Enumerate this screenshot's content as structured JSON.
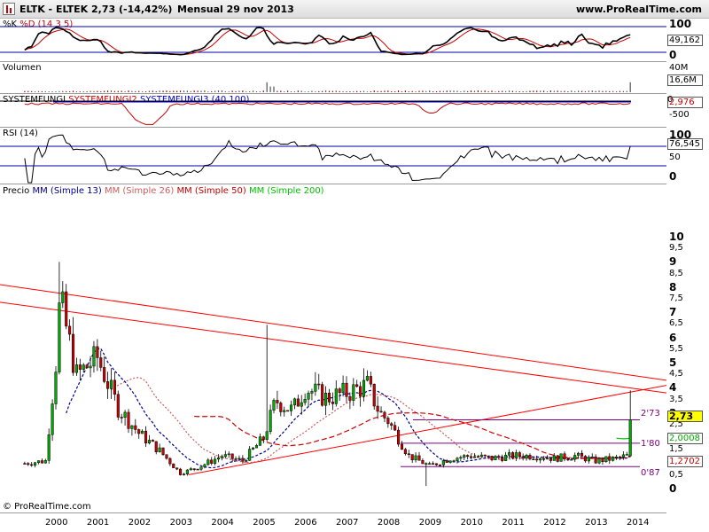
{
  "header": {
    "symbol": "ELTK - ELTEK",
    "quote": "2,73 (-14,42%)",
    "period": "Mensual  29 nov 2013",
    "site": "www.ProRealTime.com"
  },
  "stoch": {
    "title_k": "%K",
    "title_d": "%D",
    "params": "(14 3 5)",
    "ticks": [
      "100",
      "50",
      "0"
    ],
    "value": "49,162"
  },
  "volume": {
    "title": "Volumen",
    "ticks": [
      "40M",
      "0"
    ],
    "value": "16,6M"
  },
  "sysfungi": {
    "t1": "SYSTEMFUNGI",
    "t2": "SYSTEMFUNGI2",
    "t3": "SYSTEMFUNGI3 (40 100)",
    "value": "2,976",
    "ticks": [
      "0",
      "-500"
    ]
  },
  "rsi": {
    "title": "RSI (14)",
    "ticks": [
      "100",
      "50",
      "0"
    ],
    "value": "76,545"
  },
  "price": {
    "title": "Precio",
    "mm13": "MM (Simple 13)",
    "mm26": "MM (Simple 26)",
    "mm50": "MM (Simple 50)",
    "mm200": "MM (Simple 200)",
    "last": "2,73",
    "mm50_value": "2,0008",
    "mm13_value": "1,2702",
    "levels": [
      "2'73",
      "1'80",
      "0'87"
    ],
    "credit": "© ProRealTime.com"
  },
  "colors": {
    "up": "#00aa00",
    "down": "#cc0000",
    "mm13": "#00008b",
    "mm26": "#cd5c5c",
    "mm50": "#cc0000",
    "mm200": "#00c000",
    "level": "#800080",
    "trend": "#ff0000"
  },
  "chart_data": {
    "type": "candlestick",
    "period": "monthly",
    "x_range": [
      2000,
      2014
    ],
    "x_ticks": [
      "2000",
      "2001",
      "2002",
      "2003",
      "2004",
      "2005",
      "2006",
      "2007",
      "2008",
      "2009",
      "2010",
      "2011",
      "2012",
      "2013",
      "2014"
    ],
    "y_scale": "log",
    "y_ticks": [
      "10",
      "9,5",
      "9",
      "8,5",
      "8",
      "7,5",
      "7",
      "6,5",
      "6",
      "5,5",
      "5",
      "4,5",
      "4",
      "3,5",
      "3",
      "2,5",
      "2",
      "1,5",
      "1",
      "0,5",
      "0"
    ],
    "last_close": 2.73,
    "horizontal_levels": [
      2.73,
      1.8,
      0.87
    ],
    "approx_closes": [
      {
        "t": 1999.25,
        "v": 1.0
      },
      {
        "t": 1999.75,
        "v": 1.1
      },
      {
        "t": 2000.0,
        "v": 5.0
      },
      {
        "t": 2000.1,
        "v": 7.5
      },
      {
        "t": 2000.5,
        "v": 4.5
      },
      {
        "t": 2001.0,
        "v": 5.2
      },
      {
        "t": 2001.5,
        "v": 3.2
      },
      {
        "t": 2002.0,
        "v": 2.2
      },
      {
        "t": 2002.5,
        "v": 1.5
      },
      {
        "t": 2003.0,
        "v": 0.6
      },
      {
        "t": 2003.5,
        "v": 0.9
      },
      {
        "t": 2004.0,
        "v": 1.3
      },
      {
        "t": 2004.5,
        "v": 1.1
      },
      {
        "t": 2005.0,
        "v": 2.0
      },
      {
        "t": 2005.3,
        "v": 3.5
      },
      {
        "t": 2005.7,
        "v": 3.1
      },
      {
        "t": 2006.0,
        "v": 4.0
      },
      {
        "t": 2006.5,
        "v": 3.6
      },
      {
        "t": 2007.0,
        "v": 3.8
      },
      {
        "t": 2007.5,
        "v": 4.1
      },
      {
        "t": 2007.8,
        "v": 3.0
      },
      {
        "t": 2008.0,
        "v": 2.7
      },
      {
        "t": 2008.5,
        "v": 1.3
      },
      {
        "t": 2009.0,
        "v": 0.9
      },
      {
        "t": 2009.5,
        "v": 1.2
      },
      {
        "t": 2010.0,
        "v": 1.3
      },
      {
        "t": 2010.5,
        "v": 1.2
      },
      {
        "t": 2011.0,
        "v": 1.3
      },
      {
        "t": 2011.5,
        "v": 1.3
      },
      {
        "t": 2012.0,
        "v": 1.2
      },
      {
        "t": 2012.5,
        "v": 1.3
      },
      {
        "t": 2013.0,
        "v": 1.1
      },
      {
        "t": 2013.5,
        "v": 1.2
      },
      {
        "t": 2013.75,
        "v": 1.3
      },
      {
        "t": 2013.83,
        "v": 2.73
      }
    ],
    "indicators": [
      "%K %D (14 3 5)",
      "Volumen",
      "SYSTEMFUNGI (40 100)",
      "RSI (14)",
      "MM (Simple 13)",
      "MM (Simple 26)",
      "MM (Simple 50)",
      "MM (Simple 200)"
    ]
  }
}
